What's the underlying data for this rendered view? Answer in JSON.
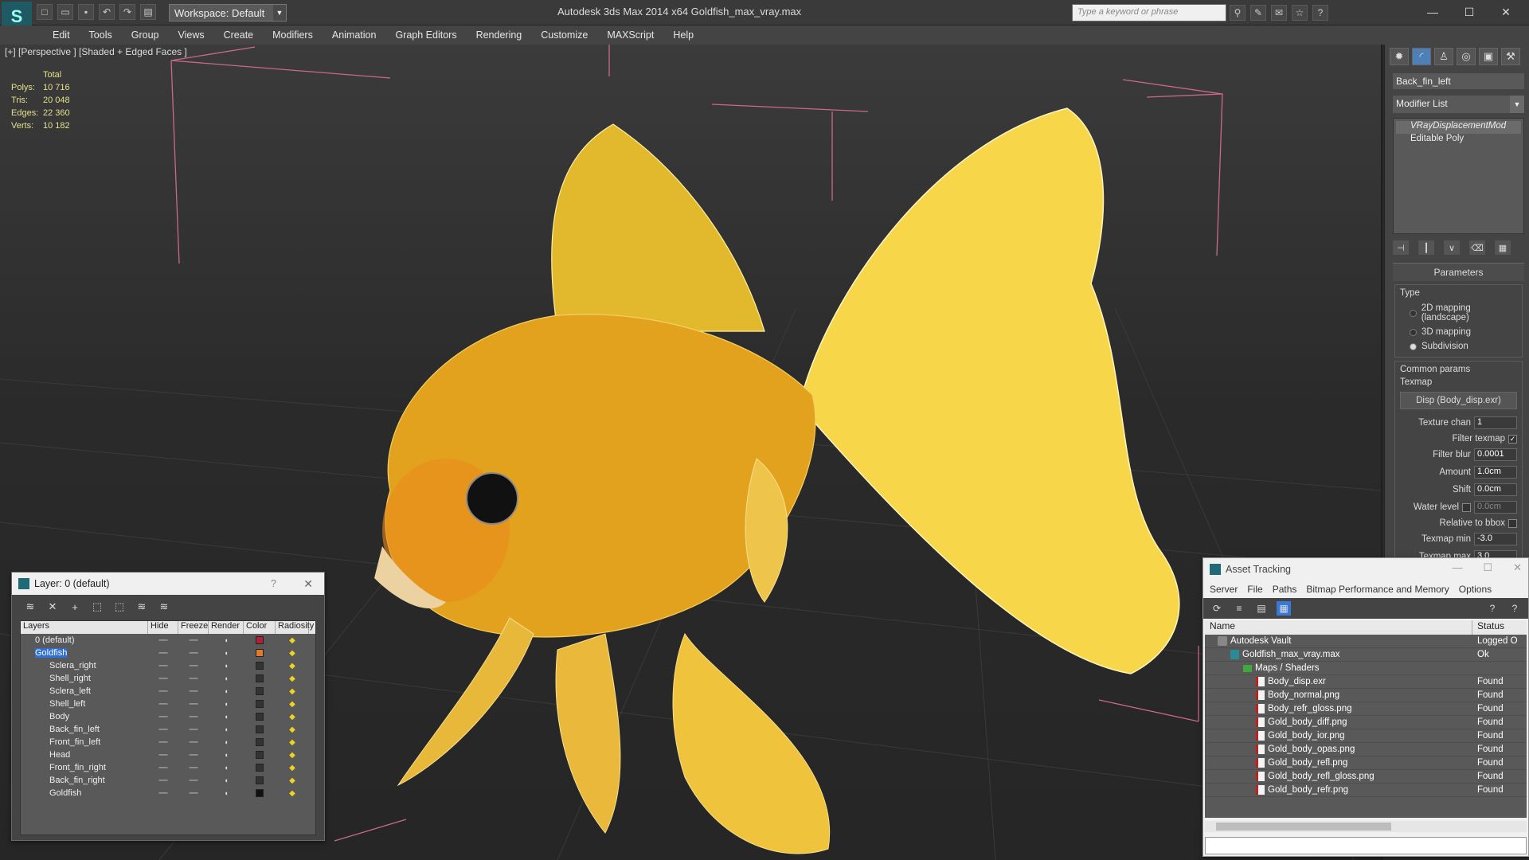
{
  "app": {
    "title": "Autodesk 3ds Max  2014 x64      Goldfish_max_vray.max",
    "workspace": "Workspace: Default",
    "search_placeholder": "Type a keyword or phrase"
  },
  "menu": [
    "Edit",
    "Tools",
    "Group",
    "Views",
    "Create",
    "Modifiers",
    "Animation",
    "Graph Editors",
    "Rendering",
    "Customize",
    "MAXScript",
    "Help"
  ],
  "viewport": {
    "label": "[+] [Perspective ] [Shaded + Edged Faces ]",
    "stats_header": "Total",
    "stats": [
      {
        "k": "Polys:",
        "v": "10 716"
      },
      {
        "k": "Tris:",
        "v": "20 048"
      },
      {
        "k": "Edges:",
        "v": "22 360"
      },
      {
        "k": "Verts:",
        "v": "10 182"
      }
    ]
  },
  "command_panel": {
    "object_name": "Back_fin_left",
    "modifier_list": "Modifier List",
    "stack": [
      "VRayDisplacementMod",
      "Editable Poly"
    ],
    "rollout_title": "Parameters",
    "type_label": "Type",
    "type_options": [
      {
        "label": "2D mapping (landscape)",
        "on": false
      },
      {
        "label": "3D mapping",
        "on": false
      },
      {
        "label": "Subdivision",
        "on": true
      }
    ],
    "common_label": "Common params",
    "texmap_label": "Texmap",
    "texmap_button": "Disp (Body_disp.exr)",
    "texture_chan_label": "Texture chan",
    "texture_chan": "1",
    "filter_texmap": "Filter texmap",
    "filter_blur_label": "Filter blur",
    "filter_blur": "0.0001",
    "amount_label": "Amount",
    "amount": "1.0cm",
    "shift_label": "Shift",
    "shift": "0.0cm",
    "water_label": "Water level",
    "water": "0.0cm",
    "relative_label": "Relative to bbox",
    "texmap_min_label": "Texmap min",
    "texmap_min": "-3.0",
    "texmap_max_label": "Texmap max",
    "texmap_max": "3.0"
  },
  "layers": {
    "title": "Layer: 0 (default)",
    "columns": [
      "Layers",
      "Hide",
      "Freeze",
      "Render",
      "Color",
      "Radiosity"
    ],
    "rows": [
      {
        "name": "0 (default)",
        "color": "#b0203a",
        "indent": 1,
        "sel": false
      },
      {
        "name": "Goldfish",
        "color": "#e07a30",
        "indent": 1,
        "sel": true
      },
      {
        "name": "Sclera_right",
        "color": "#333333",
        "indent": 2,
        "sel": false
      },
      {
        "name": "Shell_right",
        "color": "#333333",
        "indent": 2,
        "sel": false
      },
      {
        "name": "Sclera_left",
        "color": "#333333",
        "indent": 2,
        "sel": false
      },
      {
        "name": "Shell_left",
        "color": "#333333",
        "indent": 2,
        "sel": false
      },
      {
        "name": "Body",
        "color": "#333333",
        "indent": 2,
        "sel": false
      },
      {
        "name": "Back_fin_left",
        "color": "#333333",
        "indent": 2,
        "sel": false
      },
      {
        "name": "Front_fin_left",
        "color": "#333333",
        "indent": 2,
        "sel": false
      },
      {
        "name": "Head",
        "color": "#333333",
        "indent": 2,
        "sel": false
      },
      {
        "name": "Front_fin_right",
        "color": "#333333",
        "indent": 2,
        "sel": false
      },
      {
        "name": "Back_fin_right",
        "color": "#333333",
        "indent": 2,
        "sel": false
      },
      {
        "name": "Goldfish",
        "color": "#111111",
        "indent": 2,
        "sel": false
      }
    ]
  },
  "assets": {
    "title": "Asset Tracking",
    "menu": [
      "Server",
      "File",
      "Paths",
      "Bitmap Performance and Memory",
      "Options"
    ],
    "col_name": "Name",
    "col_status": "Status",
    "rows": [
      {
        "name": "Autodesk Vault",
        "status": "Logged O",
        "icon": "vault",
        "indent": 0
      },
      {
        "name": "Goldfish_max_vray.max",
        "status": "Ok",
        "icon": "max",
        "indent": 1
      },
      {
        "name": "Maps / Shaders",
        "status": "",
        "icon": "folder",
        "indent": 2
      },
      {
        "name": "Body_disp.exr",
        "status": "Found",
        "icon": "file",
        "indent": 3
      },
      {
        "name": "Body_normal.png",
        "status": "Found",
        "icon": "file",
        "indent": 3
      },
      {
        "name": "Body_refr_gloss.png",
        "status": "Found",
        "icon": "file",
        "indent": 3
      },
      {
        "name": "Gold_body_diff.png",
        "status": "Found",
        "icon": "file",
        "indent": 3
      },
      {
        "name": "Gold_body_ior.png",
        "status": "Found",
        "icon": "file",
        "indent": 3
      },
      {
        "name": "Gold_body_opas.png",
        "status": "Found",
        "icon": "file",
        "indent": 3
      },
      {
        "name": "Gold_body_refl.png",
        "status": "Found",
        "icon": "file",
        "indent": 3
      },
      {
        "name": "Gold_body_refl_gloss.png",
        "status": "Found",
        "icon": "file",
        "indent": 3
      },
      {
        "name": "Gold_body_refr.png",
        "status": "Found",
        "icon": "file",
        "indent": 3
      }
    ]
  }
}
